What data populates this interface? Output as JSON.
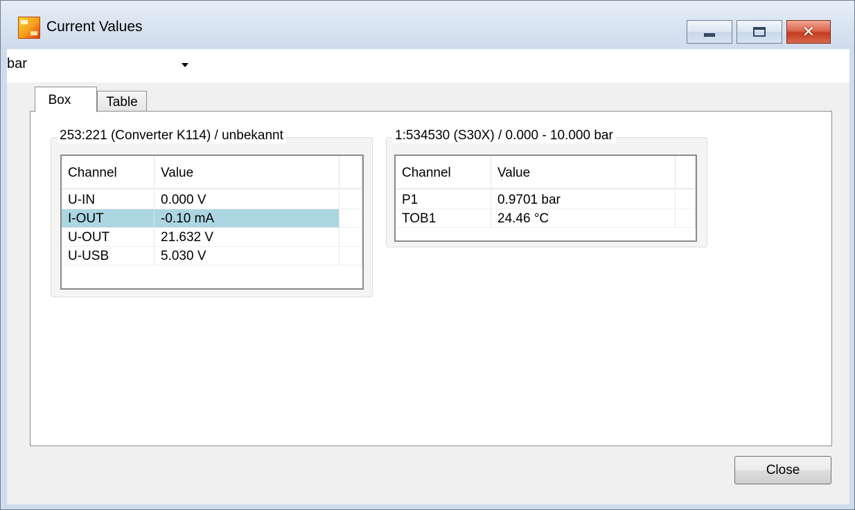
{
  "window": {
    "title": "Current Values",
    "controls": {
      "minimize": "minimize",
      "maximize": "maximize",
      "close": "close"
    }
  },
  "unit_selector": {
    "selected": "bar"
  },
  "tabs": [
    {
      "label": "Box",
      "active": true
    },
    {
      "label": "Table",
      "active": false
    }
  ],
  "devices": [
    {
      "title": "253:221 (Converter K114) / unbekannt",
      "columns": [
        "Channel",
        "Value"
      ],
      "rows": [
        {
          "channel": "U-IN",
          "value": "0.000 V"
        },
        {
          "channel": "I-OUT",
          "value": "-0.10 mA",
          "selected": true
        },
        {
          "channel": "U-OUT",
          "value": "21.632 V"
        },
        {
          "channel": "U-USB",
          "value": "5.030 V"
        }
      ]
    },
    {
      "title": "1:534530 (S30X) / 0.000 - 10.000 bar",
      "columns": [
        "Channel",
        "Value"
      ],
      "rows": [
        {
          "channel": "P1",
          "value": "0.9701 bar"
        },
        {
          "channel": "TOB1",
          "value": "24.46 °C"
        }
      ]
    }
  ],
  "footer": {
    "close_label": "Close"
  },
  "colors": {
    "selection": "#acd6e2",
    "close_button_red": "#c23c1f"
  }
}
